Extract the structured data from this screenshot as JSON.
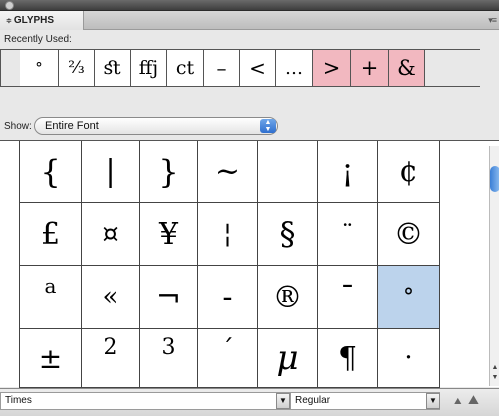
{
  "panel": {
    "tab_label": "GLYPHS",
    "tab_arrows": "≑",
    "menu_icon": "▾≡"
  },
  "recent": {
    "label": "Recently Used:",
    "glyphs": [
      "°",
      "⅔",
      "ﬆ",
      "ﬀj",
      "ct",
      "–",
      "<",
      "…",
      ">",
      "+",
      "&"
    ]
  },
  "show": {
    "label": "Show:",
    "value": "Entire Font"
  },
  "grid": {
    "rows": [
      [
        "{",
        "|",
        "}",
        "~",
        "",
        "¡",
        "¢"
      ],
      [
        "£",
        "¤",
        "¥",
        "¦",
        "§",
        "¨",
        "©"
      ],
      [
        "a",
        "«",
        "¬",
        "-",
        "®",
        "¯",
        "°"
      ],
      [
        "±",
        "2",
        "3",
        "´",
        "μ",
        "¶",
        "·"
      ]
    ],
    "selected": [
      2,
      6
    ]
  },
  "bottom": {
    "font_family": "Times",
    "font_style": "Regular"
  }
}
